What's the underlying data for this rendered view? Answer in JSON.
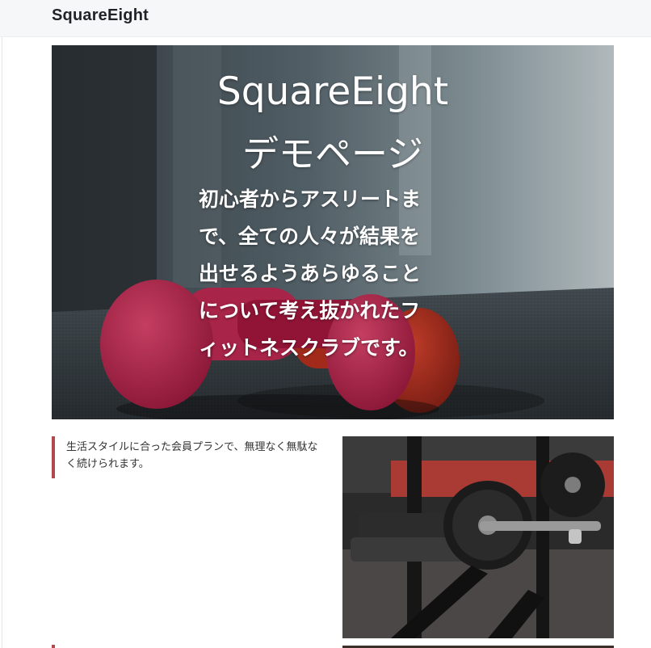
{
  "header": {
    "site_name": "SquareEight"
  },
  "hero": {
    "title_line1": "SquareEight",
    "title_line2": "デモページ",
    "lead_lines": [
      "初心者からアスリートま",
      "で、全ての人々が結果を",
      "出せるようあらゆること",
      "について考え抜かれたフ",
      "ィットネスクラブです。"
    ]
  },
  "section": {
    "description": "生活スタイルに合った会員プランで、無理なく無駄なく続けられます。"
  },
  "colors": {
    "accent": "#b3494d",
    "header_bg": "#f6f7f9"
  },
  "images": {
    "hero": "red-dumbbells-photo",
    "section": "weight-rack-photo"
  }
}
